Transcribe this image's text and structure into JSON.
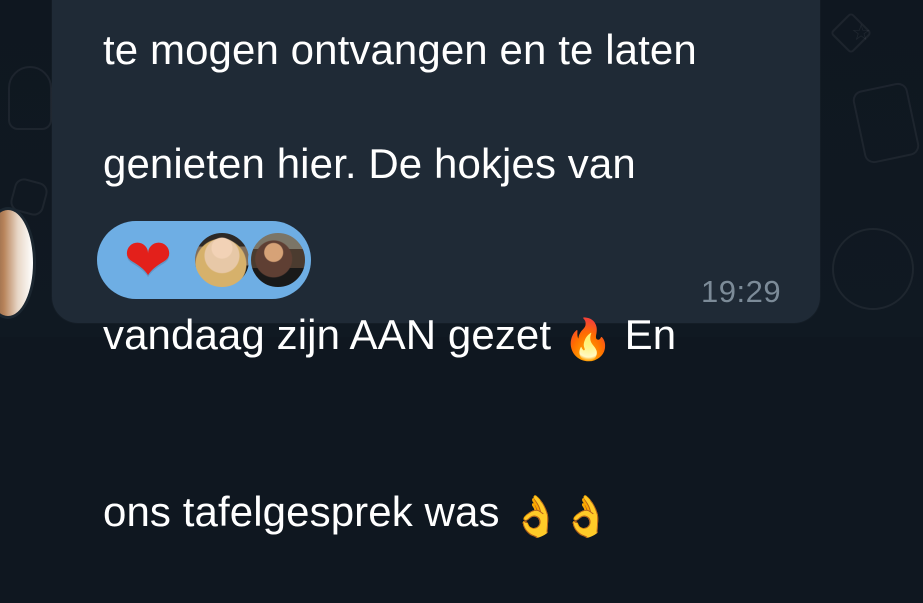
{
  "message": {
    "line_1": "te mogen ontvangen en te laten",
    "line_2": "genieten hier. De hokjes van",
    "line_3a": "vandaag zijn AAN gezet ",
    "emoji_fire": "🔥",
    "line_3b": " En",
    "line_4a": "ons tafelgesprek was ",
    "emoji_ok": "👌👌",
    "time": "19:29"
  },
  "reactions": {
    "emoji": "❤",
    "participants": [
      {
        "name": "reaction-avatar-1"
      },
      {
        "name": "reaction-avatar-2"
      }
    ]
  },
  "colors": {
    "background": "#0f1720",
    "bubble": "#1f2a36",
    "reaction_pill": "#6eaee4",
    "text": "#ffffff",
    "time": "#7c8b98",
    "heart": "#e3201b"
  },
  "icons": {
    "decorative": [
      "star-icon",
      "background-doodle-icon"
    ]
  }
}
